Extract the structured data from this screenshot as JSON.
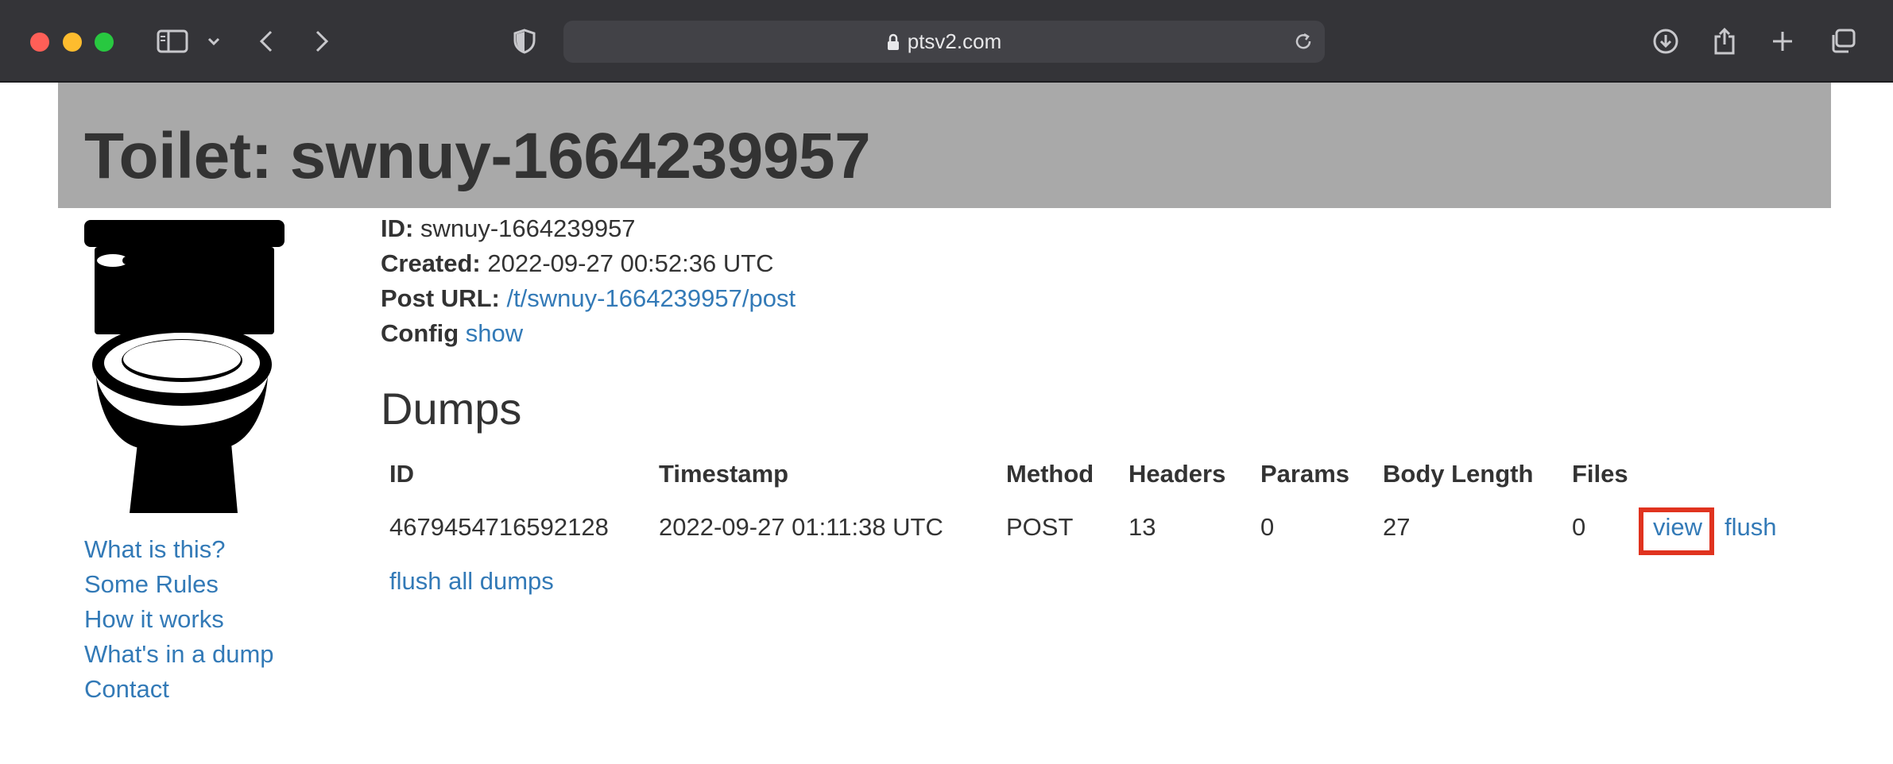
{
  "browser": {
    "url": "ptsv2.com",
    "icons": [
      "sidebar-icon",
      "chevron-down-icon",
      "back-icon",
      "forward-icon",
      "shield-icon",
      "lock-icon",
      "reload-icon",
      "download-icon",
      "share-icon",
      "new-tab-icon",
      "tabs-overview-icon"
    ]
  },
  "page": {
    "title": "Toilet: swnuy-1664239957",
    "header_bg": "#a9a9a9",
    "link_color": "#337ab7"
  },
  "meta": {
    "id_label": "ID:",
    "id_value": "swnuy-1664239957",
    "created_label": "Created:",
    "created_value": "2022-09-27 00:52:36 UTC",
    "post_url_label": "Post URL:",
    "post_url_value": "/t/swnuy-1664239957/post",
    "config_label": "Config",
    "config_link": "show"
  },
  "sidebar": {
    "links": [
      "What is this?",
      "Some Rules",
      "How it works",
      "What's in a dump",
      "Contact"
    ]
  },
  "dumps": {
    "heading": "Dumps",
    "columns": [
      "ID",
      "Timestamp",
      "Method",
      "Headers",
      "Params",
      "Body Length",
      "Files"
    ],
    "rows": [
      {
        "id": "4679454716592128",
        "timestamp": "2022-09-27 01:11:38 UTC",
        "method": "POST",
        "headers": "13",
        "params": "0",
        "body_length": "27",
        "files": "0",
        "view": "view",
        "flush": "flush"
      }
    ],
    "flush_all": "flush all dumps",
    "highlight_color": "#e0331f"
  }
}
